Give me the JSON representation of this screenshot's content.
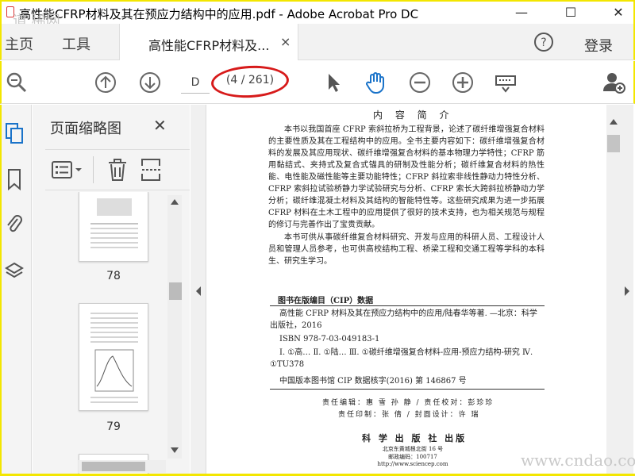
{
  "window": {
    "title": "高性能CFRP材料及其在预应力结构中的应用.pdf - Adobe Acrobat Pro DC",
    "watermark_top_left": "道 稀网",
    "minimize": "—",
    "maximize": "☐",
    "close": "✕"
  },
  "menu": {
    "home": "主页",
    "tools": "工具",
    "doc_tab": "高性能CFRP材料及...",
    "doc_tab_close": "×",
    "login": "登录"
  },
  "toolbar": {
    "page_input": "D",
    "page_count": "(4 / 261)"
  },
  "thumbnail_panel": {
    "title": "页面缩略图",
    "close": "✕",
    "pages": [
      {
        "label": "78"
      },
      {
        "label": "79"
      }
    ]
  },
  "document": {
    "heading": "内 容 简 介",
    "paragraph1": "本书以我国首座 CFRP 索斜拉桥为工程背景，论述了碳纤维增强复合材料的主要性质及其在工程结构中的应用。全书主要内容如下：碳纤维增强复合材料的发展及其应用现状、碳纤维增强复合材料的基本物理力学特性；CFRP 筋用黏结式、夹持式及复合式锚具的研制及性能分析；碳纤维复合材料的热性能、电性能及磁性能等主要功能特性；CFRP 斜拉索非线性静动力特性分析、CFRP 索斜拉试验桥静力学试验研究与分析、CFRP 索长大跨斜拉桥静动力学分析；碳纤维混凝土材料及其结构的智能特性等。这些研究成果为进一步拓展 CFRP 材料在土木工程中的应用提供了很好的技术支持，也为相关规范与规程的修订与完善作出了宝贵贡献。",
    "paragraph2": "本书可供从事碳纤维复合材料研究、开发与应用的科研人员、工程设计人员和管理人员参考，也可供高校结构工程、桥梁工程和交通工程等学科的本科生、研究生学习。",
    "cip_title": "图书在版编目（CIP）数据",
    "cip_lines": [
      "高性能 CFRP 材料及其在预应力结构中的应用/陆春华等著. —北京：科学出版社，2016",
      "ISBN 978-7-03-049183-1",
      "Ⅰ. ①高…  Ⅱ. ①陆…  Ⅲ. ①碳纤维增强复合材料-应用-预应力结构-研究  Ⅳ. ①TU378",
      "中国版本图书馆 CIP 数据核字(2016) 第 146867 号"
    ],
    "credit_line1": "责任编辑：惠 雪  孙 静 / 责任校对：彭珍珍",
    "credit_line2": "责任印制：张 倩 / 封面设计：许 瑞",
    "publisher": "科 学 出 版 社  出版",
    "publisher_addr": "北京东黄城根北街 16 号",
    "publisher_zip": "邮政编码：100717",
    "publisher_web": "http://www.sciencep.com"
  },
  "watermark_bottom_right": "www.cndao.com"
}
